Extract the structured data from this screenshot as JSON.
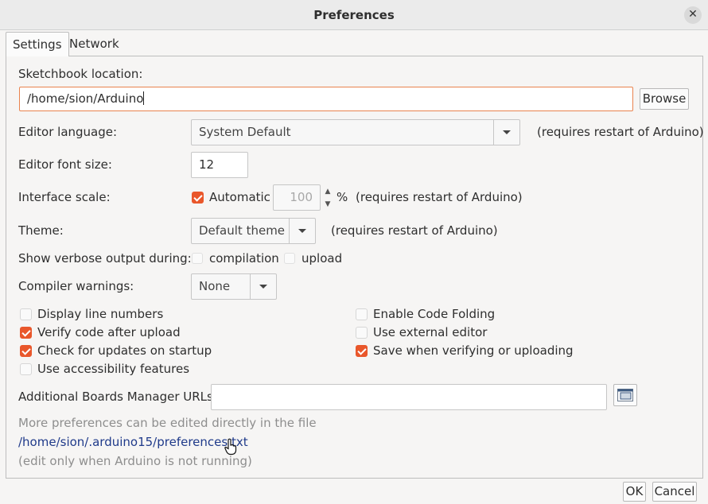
{
  "window": {
    "title": "Preferences",
    "close_glyph": "✕"
  },
  "tabs": [
    {
      "label": "Settings",
      "active": true
    },
    {
      "label": "Network",
      "active": false
    }
  ],
  "sketchbook": {
    "label": "Sketchbook location:",
    "value": "/home/sion/Arduino",
    "browse_label": "Browse"
  },
  "editor_language": {
    "label": "Editor language:",
    "value": "System Default",
    "note": "(requires restart of Arduino)"
  },
  "font_size": {
    "label": "Editor font size:",
    "value": "12"
  },
  "interface_scale": {
    "label": "Interface scale:",
    "automatic_label": "Automatic",
    "automatic_checked": true,
    "value": "100",
    "unit": "%",
    "note": "(requires restart of Arduino)"
  },
  "theme": {
    "label": "Theme:",
    "value": "Default theme",
    "note": "(requires restart of Arduino)"
  },
  "verbose": {
    "label": "Show verbose output during:",
    "compilation_label": "compilation",
    "compilation_checked": false,
    "upload_label": "upload",
    "upload_checked": false
  },
  "compiler_warnings": {
    "label": "Compiler warnings:",
    "value": "None"
  },
  "options": {
    "display_line_numbers": {
      "label": "Display line numbers",
      "checked": false
    },
    "verify_after_upload": {
      "label": "Verify code after upload",
      "checked": true
    },
    "check_updates": {
      "label": "Check for updates on startup",
      "checked": true
    },
    "accessibility": {
      "label": "Use accessibility features",
      "checked": false
    },
    "code_folding": {
      "label": "Enable Code Folding",
      "checked": false
    },
    "external_editor": {
      "label": "Use external editor",
      "checked": false
    },
    "save_when_verifying": {
      "label": "Save when verifying or uploading",
      "checked": true
    }
  },
  "boards_urls": {
    "label": "Additional Boards Manager URLs:",
    "value": ""
  },
  "footer": {
    "more_text": "More preferences can be edited directly in the file",
    "path": "/home/sion/.arduino15/preferences.txt",
    "edit_note": "(edit only when Arduino is not running)"
  },
  "buttons": {
    "ok": "OK",
    "cancel": "Cancel"
  },
  "colors": {
    "accent": "#e9572b",
    "focus_border": "#e9834e",
    "link": "#1f3a8a"
  }
}
